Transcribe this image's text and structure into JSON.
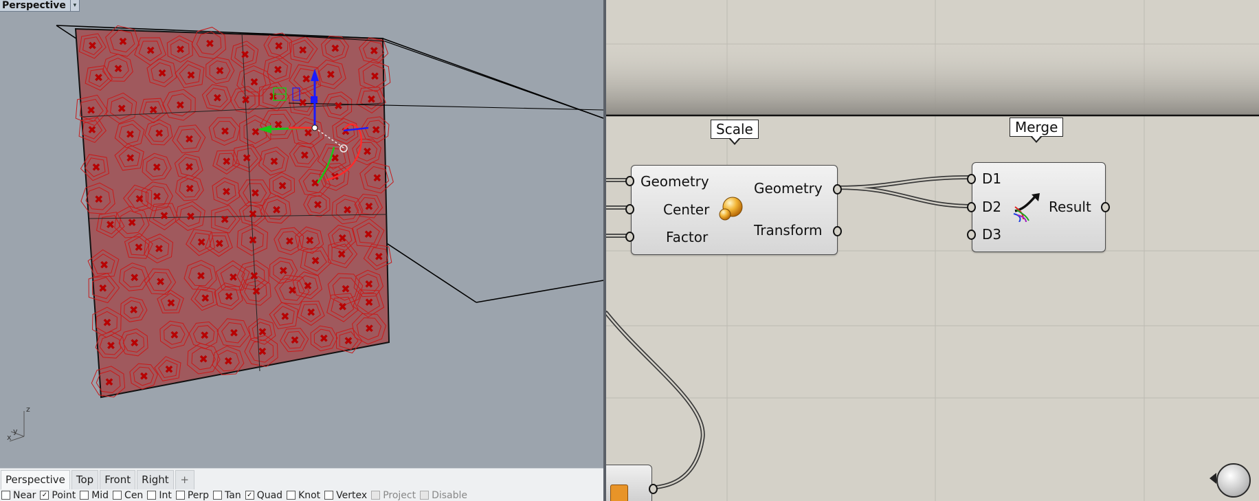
{
  "viewport": {
    "title": "Perspective",
    "dropdown_glyph": "▾",
    "axis_z": "z",
    "axis_x": "x",
    "axis_y": "y"
  },
  "view_tabs": [
    {
      "label": "Perspective",
      "active": true
    },
    {
      "label": "Top",
      "active": false
    },
    {
      "label": "Front",
      "active": false
    },
    {
      "label": "Right",
      "active": false
    },
    {
      "label": "+",
      "active": false
    }
  ],
  "osnaps": [
    {
      "label": "Near",
      "checked": false,
      "enabled": true
    },
    {
      "label": "Point",
      "checked": true,
      "enabled": true
    },
    {
      "label": "Mid",
      "checked": false,
      "enabled": true
    },
    {
      "label": "Cen",
      "checked": false,
      "enabled": true
    },
    {
      "label": "Int",
      "checked": false,
      "enabled": true
    },
    {
      "label": "Perp",
      "checked": false,
      "enabled": true
    },
    {
      "label": "Tan",
      "checked": false,
      "enabled": true
    },
    {
      "label": "Quad",
      "checked": true,
      "enabled": true
    },
    {
      "label": "Knot",
      "checked": false,
      "enabled": true
    },
    {
      "label": "Vertex",
      "checked": false,
      "enabled": true
    },
    {
      "label": "Project",
      "checked": false,
      "enabled": false
    },
    {
      "label": "Disable",
      "checked": false,
      "enabled": false
    }
  ],
  "grasshopper": {
    "scale": {
      "bubble": "Scale",
      "inputs": [
        "Geometry",
        "Center",
        "Factor"
      ],
      "outputs": [
        "Geometry",
        "Transform"
      ]
    },
    "merge": {
      "bubble": "Merge",
      "inputs": [
        "D1",
        "D2",
        "D3"
      ],
      "outputs": [
        "Result"
      ]
    }
  },
  "colors": {
    "surface": "#a0595d",
    "cells": "#c81a1a",
    "points": "#b80000",
    "canvas": "#d4d1c8",
    "viewport_bg": "#9ca4ad"
  },
  "icons": {
    "scale": "scale-icon",
    "merge": "merge-icon",
    "navigator": "navigation-ball-icon",
    "dropdown": "chevron-down-icon"
  }
}
